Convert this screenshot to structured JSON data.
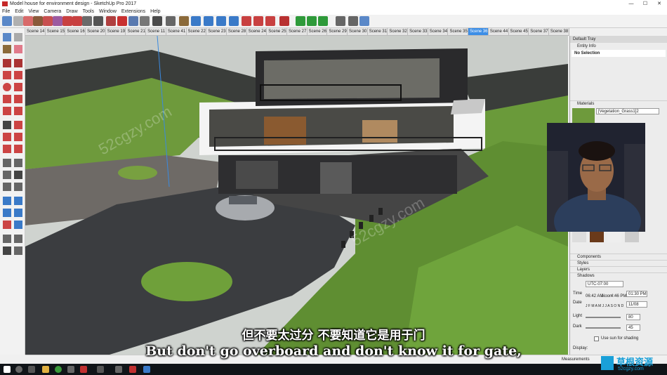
{
  "window": {
    "title": "Model house for environment design - SketchUp Pro 2017",
    "minimize": "—",
    "maximize": "☐",
    "close": "✕"
  },
  "menu": [
    "File",
    "Edit",
    "View",
    "Camera",
    "Draw",
    "Tools",
    "Window",
    "Extensions",
    "Help"
  ],
  "scenes": {
    "tabs": [
      "Scene 14",
      "Scene 15",
      "Scene 16",
      "Scene 20",
      "Scene 19",
      "Scene 21",
      "Scene 11",
      "Scene 41",
      "Scene 22",
      "Scene 23",
      "Scene 28",
      "Scene 24",
      "Scene 25",
      "Scene 27",
      "Scene 26",
      "Scene 29",
      "Scene 30",
      "Scene 31",
      "Scene 32",
      "Scene 33",
      "Scene 34",
      "Scene 35",
      "Scene 36",
      "Scene 44",
      "Scene 45",
      "Scene 37",
      "Scene 38",
      "Scene 39",
      "Scene 40",
      "Scene 42",
      "Scene 43"
    ],
    "active": "Scene 36"
  },
  "tray": {
    "title": "Default Tray",
    "entity_info": "Entity Info",
    "no_selection": "No Selection",
    "materials": "Materials",
    "material_name": "[Vegetation_Grass1]2",
    "components": "Components",
    "styles": "Styles",
    "layers": "Layers",
    "shadows": "Shadows",
    "timezone": "UTC-07:00",
    "time_label": "Time",
    "time_start": "06:42 AM",
    "time_noon": "Noon",
    "time_end": "4:46 PM",
    "time_value": "01:30 PM",
    "date_label": "Date",
    "months": "J F M A M J J A S O N D",
    "date_value": "11/08",
    "light_label": "Light",
    "light_value": "80",
    "dark_label": "Dark",
    "dark_value": "45",
    "use_sun": "Use sun for shading",
    "display_label": "Display:"
  },
  "status": {
    "measurements": "Measurements"
  },
  "subtitles": {
    "cn": "但不要太过分 不要知道它是用于门",
    "en": "But don't go overboard and don't know it for gate,"
  },
  "watermarks": {
    "site_cn": "草根资源",
    "site_url": "52cgzy.com",
    "overlay": "52cgzy.com"
  }
}
